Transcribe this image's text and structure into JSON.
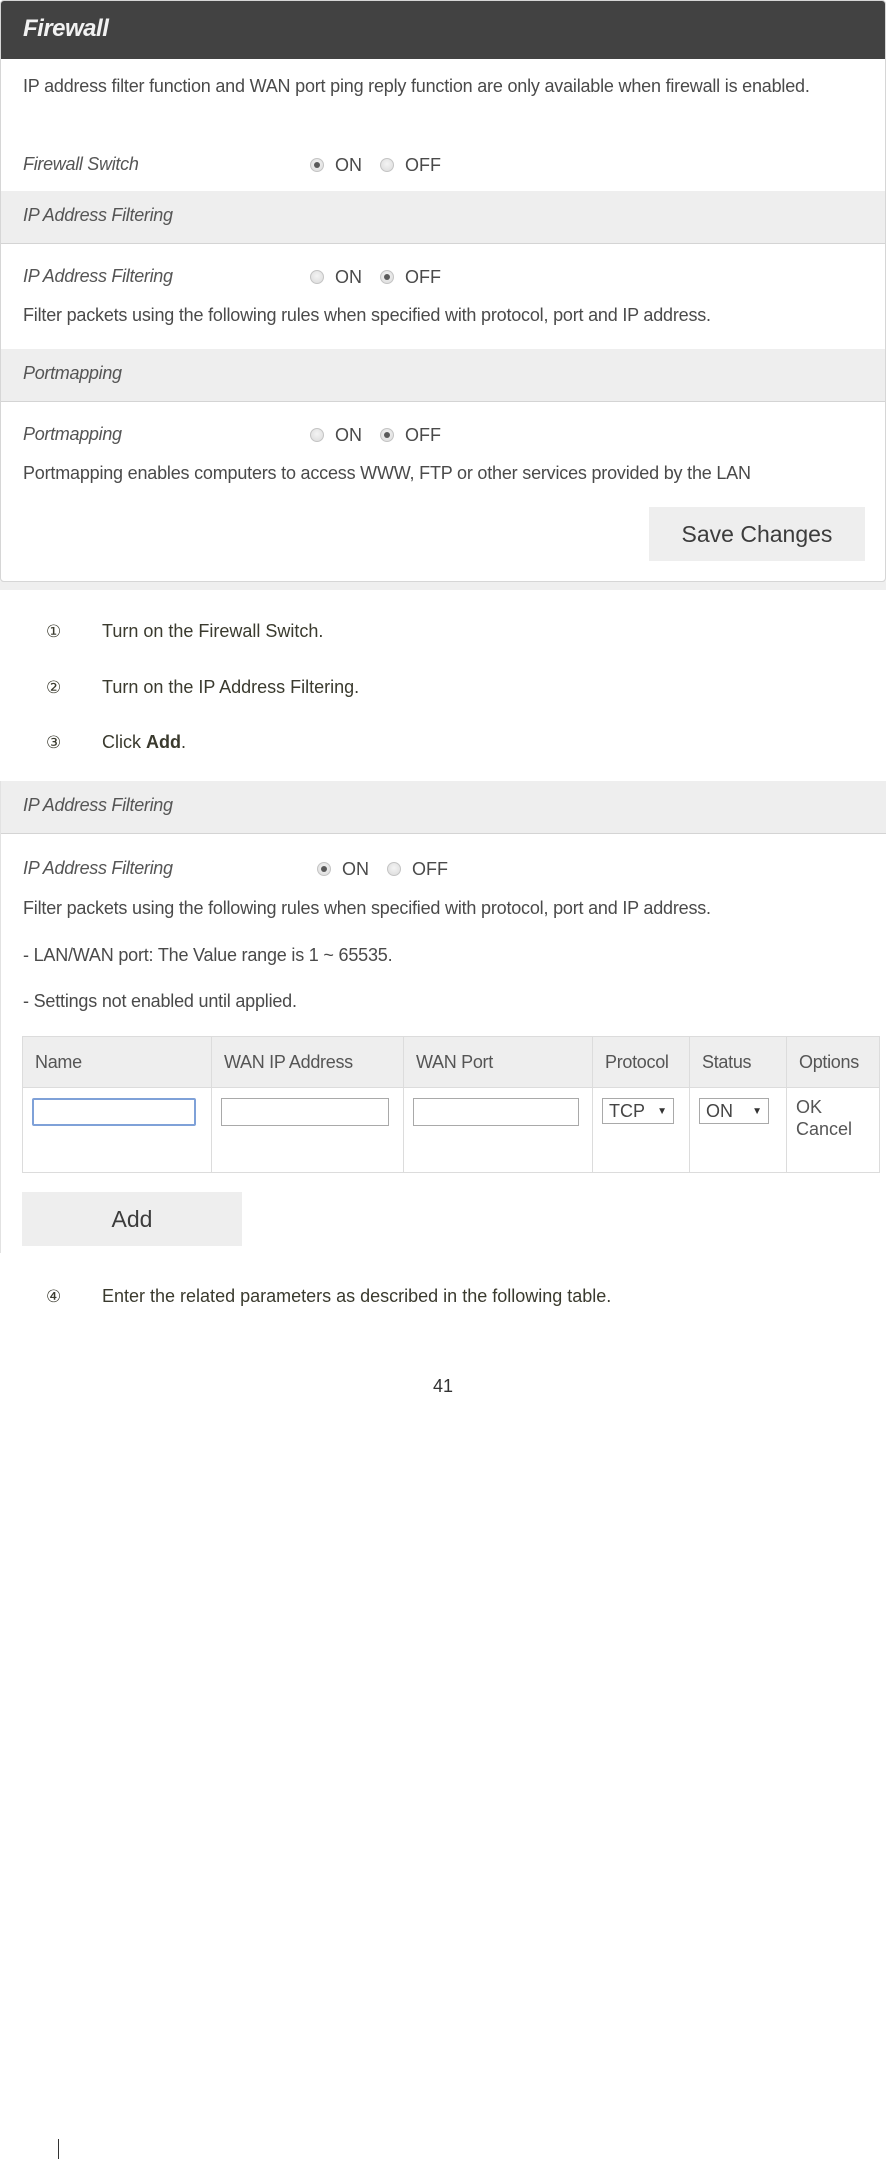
{
  "firewall_panel": {
    "title": "Firewall",
    "description": "IP address filter function and WAN port ping reply function are only available when firewall is enabled.",
    "firewall_switch": {
      "label": "Firewall Switch",
      "on_label": "ON",
      "off_label": "OFF",
      "selected": "ON"
    },
    "ip_filtering_section": {
      "heading": "IP Address Filtering",
      "label": "IP Address Filtering",
      "on_label": "ON",
      "off_label": "OFF",
      "selected": "OFF",
      "description": "Filter packets using the following rules when specified with protocol, port and IP address."
    },
    "portmapping_section": {
      "heading": "Portmapping",
      "label": "Portmapping",
      "on_label": "ON",
      "off_label": "OFF",
      "selected": "OFF",
      "description": "Portmapping enables computers to access WWW, FTP or other services provided by the LAN"
    },
    "save_label": "Save Changes"
  },
  "steps": [
    {
      "num": "①",
      "text": "Turn on the Firewall Switch."
    },
    {
      "num": "②",
      "text": "Turn on the IP Address Filtering."
    },
    {
      "num": "③",
      "text_before": "Click ",
      "bold": "Add",
      "text_after": "."
    },
    {
      "num": "④",
      "text": "Enter the related parameters as described in the following table."
    }
  ],
  "ip_filter_panel": {
    "heading": "IP Address Filtering",
    "label": "IP Address Filtering",
    "on_label": "ON",
    "off_label": "OFF",
    "selected": "ON",
    "description": "Filter packets using the following rules when specified with protocol, port and IP address.",
    "note1": "- LAN/WAN port: The Value range is 1 ~ 65535.",
    "note2": "- Settings not enabled until applied.",
    "table": {
      "columns": [
        "Name",
        "WAN IP Address",
        "WAN Port",
        "Protocol",
        "Status",
        "Options"
      ],
      "row": {
        "name_value": "",
        "wan_ip_value": "",
        "wan_port_value": "",
        "protocol_selected": "TCP",
        "status_selected": "ON",
        "ok_label": "OK",
        "cancel_label": "Cancel"
      }
    },
    "add_label": "Add"
  },
  "page_number": "41"
}
